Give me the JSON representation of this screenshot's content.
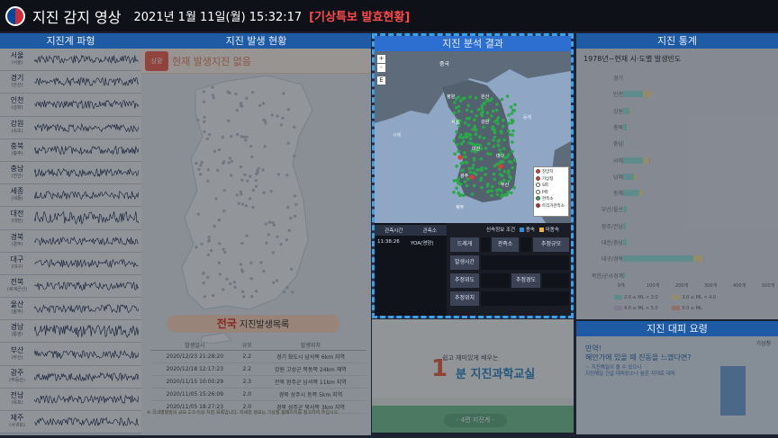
{
  "header": {
    "title": "지진 감지 영상",
    "datetime": "2021년 1월 11일(월) 15:32:17",
    "alert": "[기상특보 발효현황]"
  },
  "waveform": {
    "title": "지진계 파형",
    "stations": [
      {
        "name": "서울",
        "sub": "(서울)"
      },
      {
        "name": "경기",
        "sub": "(안산)"
      },
      {
        "name": "인천",
        "sub": "(강화)"
      },
      {
        "name": "강원",
        "sub": "(속초)"
      },
      {
        "name": "충북",
        "sub": "(충주)"
      },
      {
        "name": "충남",
        "sub": "(천안)"
      },
      {
        "name": "세종",
        "sub": "(세종)"
      },
      {
        "name": "대전",
        "sub": "(대전)"
      },
      {
        "name": "경북",
        "sub": "(경주)"
      },
      {
        "name": "대구",
        "sub": "(대구)"
      },
      {
        "name": "전북",
        "sub": "(세계군산)"
      },
      {
        "name": "울산",
        "sub": "(울주)"
      },
      {
        "name": "경남",
        "sub": "(통영)"
      },
      {
        "name": "부산",
        "sub": "(부산)"
      },
      {
        "name": "광주",
        "sub": "(무등산)"
      },
      {
        "name": "전남",
        "sub": "(목포)"
      },
      {
        "name": "제주",
        "sub": "(서귀포)"
      }
    ]
  },
  "occurrence": {
    "title": "지진 발생 현황",
    "notice_icon": "상황",
    "notice": "현재 발생지진 없음",
    "list_highlight": "전국",
    "list_title": "지진발생목록",
    "columns": [
      "발생일시",
      "규모",
      "발생위치"
    ],
    "rows": [
      [
        "2020/12/23 21:28:20",
        "2.2",
        "경기 화도시 남서쪽 6km 지역"
      ],
      [
        "2020/12/18 12:17:23",
        "2.2",
        "강원 고성군 북동쪽 24km 해역"
      ],
      [
        "2020/11/15 10:00:29",
        "2.3",
        "전북 완주군 남서쪽 11km 지역"
      ],
      [
        "2020/11/05 15:26:09",
        "2.0",
        "경북 상주시 동쪽 5km 지역"
      ],
      [
        "2020/11/05 18:27:23",
        "2.0",
        "경북 성주군 북서쪽 3km 지역"
      ]
    ],
    "footnote": "※ 국내영향권의 규모 2.0 이상 지진 목록입니다. 자세한 정보는 기상청 홈페이지를 참고하여 주십시오."
  },
  "analysis": {
    "title": "지진 분석 결과",
    "zoom_in": "+",
    "zoom_out": "-",
    "layer_btn": "E",
    "sea_west": "서해",
    "sea_east": "동해",
    "places": [
      "중국",
      "평양",
      "원산",
      "서울",
      "강원",
      "대전",
      "대구",
      "광주",
      "부산",
      "제주"
    ],
    "legend": [
      {
        "label": "진앙지",
        "color": "#e23b2f"
      },
      {
        "label": "기상청",
        "color": "#e23b2f"
      },
      {
        "label": "S파",
        "color": "#ffffff"
      },
      {
        "label": "P파",
        "color": "#ffffff"
      },
      {
        "label": "관측소",
        "color": "#2aa84a"
      },
      {
        "label": "트리거관측소",
        "color": "#d21d1d"
      }
    ],
    "strip": {
      "col1": "관측시간",
      "col2": "관측소",
      "sensor_label": "신속정보 조건",
      "normal_label": "종속",
      "alert_label": "미종속",
      "time": "11:38:26",
      "station": "YOA(영양)"
    },
    "cells": [
      "드래게",
      "관측소",
      "추정규모",
      "발생시간",
      "추정위도",
      "추정경도",
      "추정위치"
    ],
    "colors": {
      "normal": "#2f8fe0",
      "alert": "#f0b43a"
    }
  },
  "stats": {
    "title": "지진 통계",
    "subtitle": "1978년~현재 시·도별 발생빈도",
    "regions": [
      {
        "name": "경기",
        "v1": 0,
        "v2": 0,
        "v3": 0
      },
      {
        "name": "인천",
        "v1": 68,
        "v2": 28,
        "v3": 0
      },
      {
        "name": "강원",
        "v1": 22,
        "v2": 6,
        "v3": 0
      },
      {
        "name": "충북",
        "v1": 13,
        "v2": 0,
        "v3": 0
      },
      {
        "name": "충남",
        "v1": 3,
        "v2": 0,
        "v3": 0
      },
      {
        "name": "서해",
        "v1": 68,
        "v2": 22,
        "v3": 4
      },
      {
        "name": "남해",
        "v1": 38,
        "v2": 8,
        "v3": 0
      },
      {
        "name": "동해",
        "v1": 55,
        "v2": 14,
        "v3": 0
      },
      {
        "name": "부산/울산",
        "v1": 14,
        "v2": 2,
        "v3": 0
      },
      {
        "name": "광주/전남",
        "v1": 8,
        "v2": 0,
        "v3": 0
      },
      {
        "name": "대전/충남",
        "v1": 12,
        "v2": 0,
        "v3": 0
      },
      {
        "name": "대구/경북",
        "v1": 245,
        "v2": 32,
        "v3": 3
      },
      {
        "name": "북한/군사경계",
        "v1": 7,
        "v2": 0,
        "v3": 0
      }
    ],
    "xticks": [
      "0개",
      "100개",
      "200개",
      "300개",
      "400개",
      "500개"
    ],
    "xmax": 500,
    "legend": [
      {
        "label": "2.0 ≤ ML < 3.0",
        "color": "#9be6e0"
      },
      {
        "label": "3.0 ≤ ML < 4.0",
        "color": "#f6e6a6"
      },
      {
        "label": "4.0 ≤ ML < 5.0",
        "color": "#d9c5ec"
      },
      {
        "label": "5.0 ≤ ML",
        "color": "#f5b7a2"
      }
    ]
  },
  "edu": {
    "top": "쉽고 재미있게 배우는",
    "number": "1",
    "unit": "분",
    "main": "지진과학교실",
    "button": "- 4편 지진계 -"
  },
  "guide": {
    "title": "지진 대피 요령",
    "q1": "만약!",
    "q2": "혜안가에 있을 때 진동을 느꼈다면?",
    "line1": "☞ 지진해일이 올 수 있으니",
    "line2": "지진해일 긴급 대피장소나 높은 지대로 대피",
    "brand": "기상청"
  }
}
